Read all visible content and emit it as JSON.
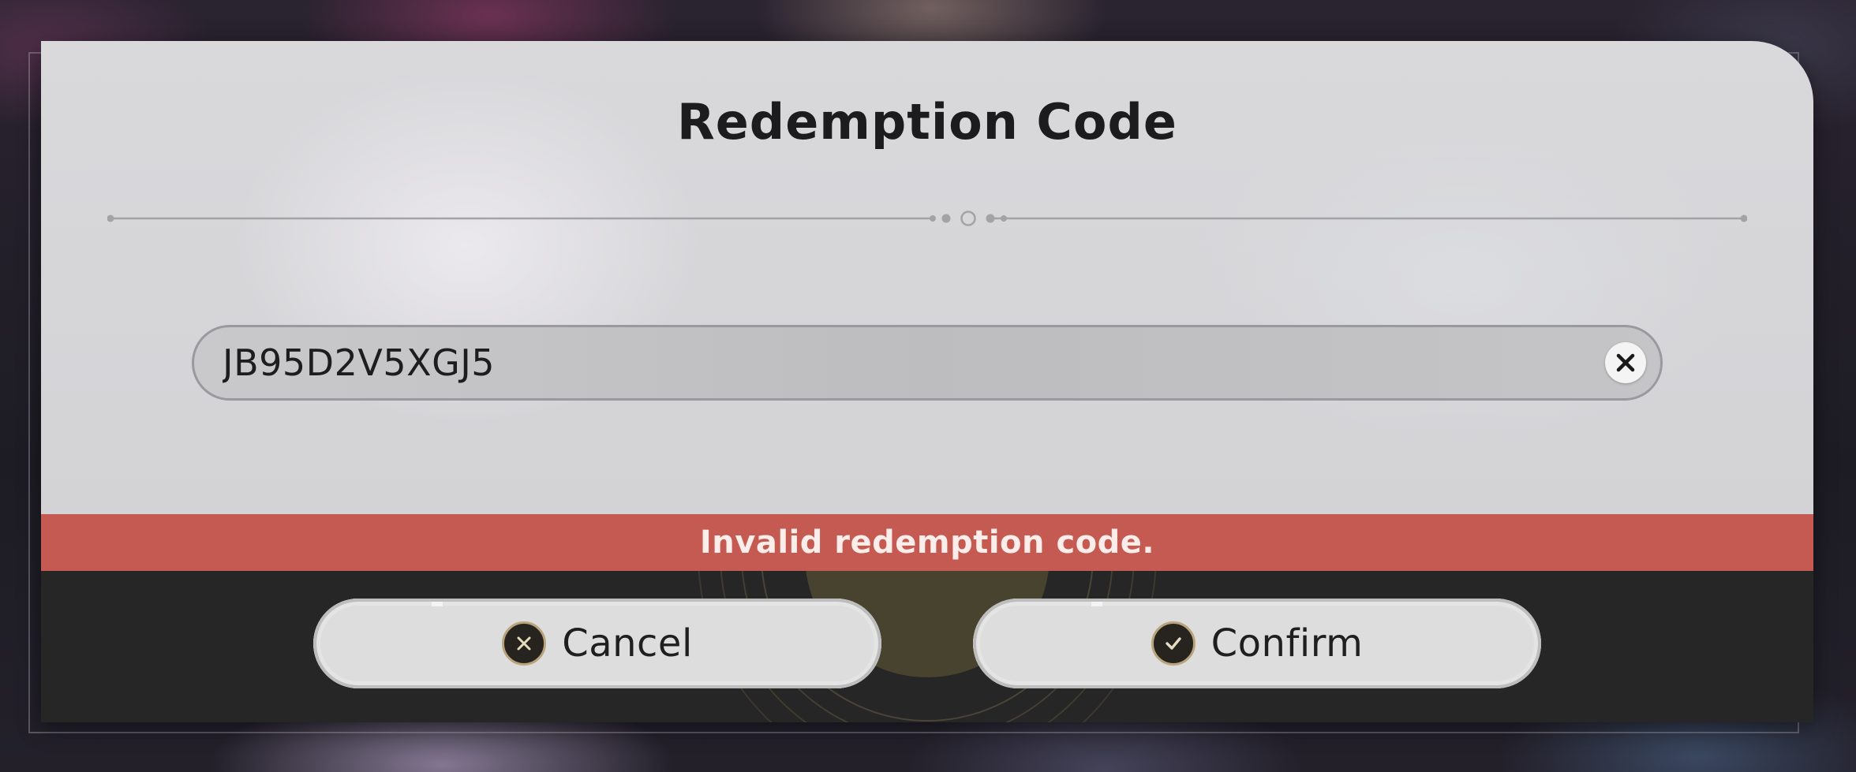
{
  "dialog": {
    "title": "Redemption Code",
    "code_input": {
      "value": "JB95D2V5XGJ5",
      "placeholder": ""
    },
    "clear_icon": "close-icon",
    "error_message": "Invalid redemption code.",
    "buttons": {
      "cancel_label": "Cancel",
      "cancel_icon": "x-circle-icon",
      "confirm_label": "Confirm",
      "confirm_icon": "check-circle-icon"
    }
  },
  "colors": {
    "error_bar": "#c55a52",
    "footer": "#262626",
    "button_icon_ring": "#b9a57c"
  }
}
